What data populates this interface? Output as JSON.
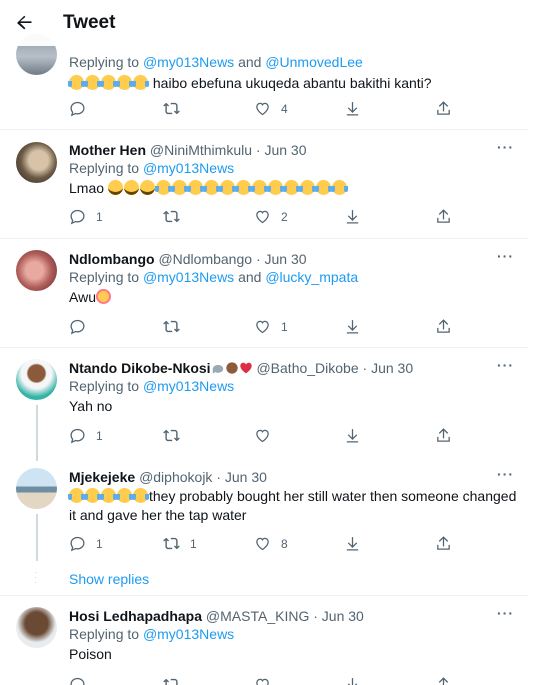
{
  "header": {
    "title": "Tweet"
  },
  "tweets": [
    {
      "replying_prefix": "Replying to ",
      "replying_1": "@my013News",
      "replying_and": " and ",
      "replying_2": "@UnmovedLee",
      "text": "haibo ebefuna ukuqeda abantu bakithi kanti?",
      "reply_count": "",
      "retweet_count": "",
      "like_count": "4"
    },
    {
      "name": "Mother Hen",
      "handle": "@NiniMthimkulu",
      "dot": "·",
      "date": "Jun 30",
      "replying_prefix": "Replying to ",
      "replying_1": "@my013News",
      "text": "Lmao",
      "reply_count": "1",
      "retweet_count": "",
      "like_count": "2"
    },
    {
      "name": "Ndlombango",
      "handle": "@Ndlombango",
      "dot": "·",
      "date": "Jun 30",
      "replying_prefix": "Replying to ",
      "replying_1": "@my013News",
      "replying_and": " and ",
      "replying_2": "@lucky_mpata",
      "text": "Awu",
      "reply_count": "",
      "retweet_count": "",
      "like_count": "1"
    },
    {
      "name": "Ntando Dikobe-Nkosi",
      "handle": "@Batho_Dikobe",
      "dot": "·",
      "date": "Jun 30",
      "replying_prefix": "Replying to ",
      "replying_1": "@my013News",
      "text": "Yah no",
      "reply_count": "1",
      "retweet_count": "",
      "like_count": ""
    },
    {
      "name": "Mjekejeke",
      "handle": "@diphokojk",
      "dot": "·",
      "date": "Jun 30",
      "text": "they probably bought her still water then someone changed it and gave her the tap water",
      "reply_count": "1",
      "retweet_count": "1",
      "like_count": "8"
    },
    {
      "name": "Hosi Ledhapadhapa",
      "handle": "@MASTA_KING",
      "dot": "·",
      "date": "Jun 30",
      "replying_prefix": "Replying to ",
      "replying_1": "@my013News",
      "text": "Poison"
    }
  ],
  "show_replies": "Show replies",
  "more_label": "···",
  "icons": [
    "back-arrow-icon",
    "reply-icon",
    "retweet-icon",
    "like-icon",
    "download-icon",
    "share-icon",
    "more-icon"
  ],
  "colors": {
    "link": "#1d9bf0",
    "muted": "#536471",
    "text": "#0f1419",
    "divider": "#eff3f4"
  }
}
